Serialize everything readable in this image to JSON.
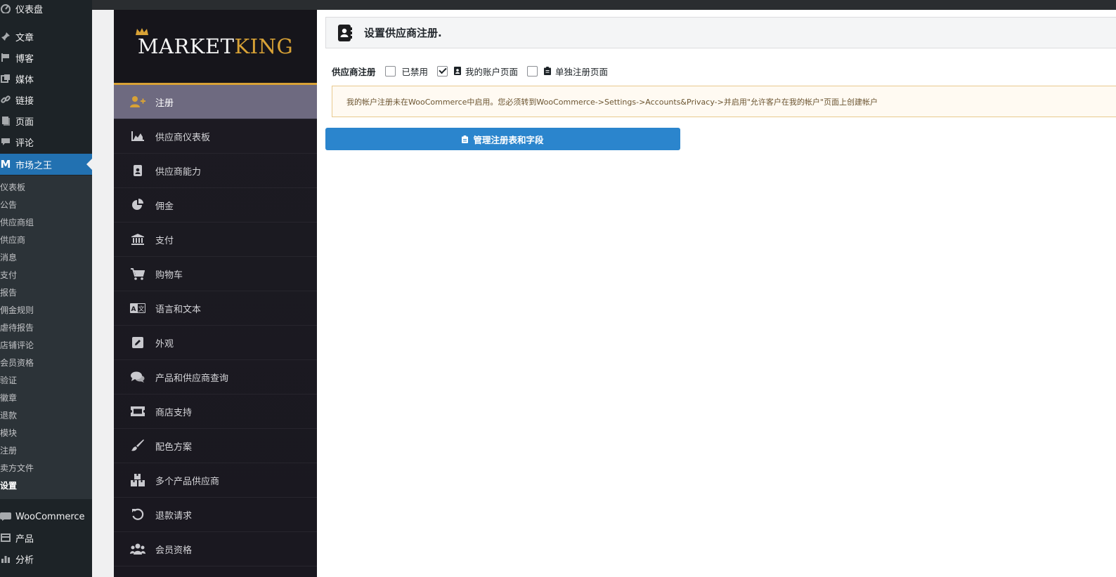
{
  "wp_menu": [
    {
      "id": "dashboard",
      "label": "仪表盘",
      "icon": "dashboard-icon"
    },
    {
      "id": "posts",
      "label": "文章",
      "icon": "pin-icon"
    },
    {
      "id": "blog",
      "label": "博客",
      "icon": "flag-icon"
    },
    {
      "id": "media",
      "label": "媒体",
      "icon": "media-icon"
    },
    {
      "id": "links",
      "label": "链接",
      "icon": "link-icon"
    },
    {
      "id": "pages",
      "label": "页面",
      "icon": "page-icon"
    },
    {
      "id": "comments",
      "label": "评论",
      "icon": "comment-icon"
    },
    {
      "id": "marketking",
      "label": "市场之王",
      "icon": "marketking-m-icon",
      "active": true
    },
    {
      "id": "woocommerce",
      "label": "WooCommerce",
      "icon": "woo-icon"
    },
    {
      "id": "products",
      "label": "产品",
      "icon": "product-icon"
    },
    {
      "id": "analytics",
      "label": "分析",
      "icon": "analytics-icon"
    }
  ],
  "wp_submenu": [
    {
      "label": "仪表板"
    },
    {
      "label": "公告"
    },
    {
      "label": "供应商组"
    },
    {
      "label": "供应商"
    },
    {
      "label": "消息"
    },
    {
      "label": "支付"
    },
    {
      "label": "报告"
    },
    {
      "label": "佣金规则"
    },
    {
      "label": "虐待报告"
    },
    {
      "label": "店铺评论"
    },
    {
      "label": "会员资格"
    },
    {
      "label": "验证"
    },
    {
      "label": "徽章"
    },
    {
      "label": "退款"
    },
    {
      "label": "模块"
    },
    {
      "label": "注册"
    },
    {
      "label": "卖方文件"
    },
    {
      "label": "设置",
      "current": true
    }
  ],
  "logo": {
    "part1": "MARKET",
    "part2": "KING"
  },
  "mk_menu": [
    {
      "label": "注册",
      "icon": "user-plus-icon",
      "active": true
    },
    {
      "label": "供应商仪表板",
      "icon": "area-chart-icon"
    },
    {
      "label": "供应商能力",
      "icon": "id-badge-icon"
    },
    {
      "label": "佣金",
      "icon": "pie-chart-icon"
    },
    {
      "label": "支付",
      "icon": "bank-icon"
    },
    {
      "label": "购物车",
      "icon": "cart-icon"
    },
    {
      "label": "语言和文本",
      "icon": "language-icon"
    },
    {
      "label": "外观",
      "icon": "edit-icon"
    },
    {
      "label": "产品和供应商查询",
      "icon": "comments-icon"
    },
    {
      "label": "商店支持",
      "icon": "ticket-icon"
    },
    {
      "label": "配色方案",
      "icon": "brush-icon"
    },
    {
      "label": "多个产品供应商",
      "icon": "boxes-icon"
    },
    {
      "label": "退款请求",
      "icon": "undo-icon"
    },
    {
      "label": "会员资格",
      "icon": "users-icon"
    }
  ],
  "header": {
    "title": "设置供应商注册.",
    "icon": "address-book-icon"
  },
  "options": {
    "label": "供应商注册",
    "items": [
      {
        "label": "已禁用",
        "checked": false,
        "icon": ""
      },
      {
        "label": "我的账户页面",
        "checked": true,
        "icon": "id-card-icon"
      },
      {
        "label": "单独注册页面",
        "checked": false,
        "icon": "clipboard-icon"
      }
    ]
  },
  "notice": {
    "text": "我的帐户注册未在WooCommerce中启用。您必须转到WooCommerce->Settings->Accounts&Privacy->并启用\"允许客户在我的帐户\"页面上创建帐户"
  },
  "manage_button": {
    "label": "管理注册表和字段",
    "icon": "clipboard-icon"
  },
  "colors": {
    "accent": "#2b85cd",
    "wp_active": "#2271b1",
    "gold": "#d8a236"
  }
}
